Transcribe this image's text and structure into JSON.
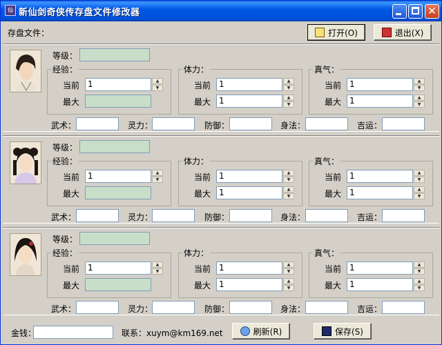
{
  "window": {
    "title": "新仙剑奇侠传存盘文件修改器",
    "icon": "app-icon",
    "controls": {
      "minimize": "minimize-icon",
      "maximize": "maximize-icon",
      "close": "close-icon"
    }
  },
  "toolbar": {
    "save_file_label": "存盘文件：",
    "open_label": "打开(O)",
    "exit_label": "退出(X)",
    "exit_icon_text": "EXIT"
  },
  "labels": {
    "level": "等级：",
    "exp": "经验：",
    "hp": "体力：",
    "mp": "真气：",
    "current": "当前",
    "max": "最大",
    "wushu": "武术：",
    "lingli": "灵力：",
    "fangyu": "防御：",
    "shenfa": "身法：",
    "jiyun": "吉运："
  },
  "characters": [
    {
      "name_icon": "li-xiaoyao-portrait",
      "level": "",
      "exp_current": "1",
      "exp_max": "",
      "hp_current": "1",
      "hp_max": "1",
      "mp_current": "1",
      "mp_max": "1",
      "wushu": "",
      "lingli": "",
      "fangyu": "",
      "shenfa": "",
      "jiyun": ""
    },
    {
      "name_icon": "zhao-linger-portrait",
      "level": "",
      "exp_current": "1",
      "exp_max": "",
      "hp_current": "1",
      "hp_max": "1",
      "mp_current": "1",
      "mp_max": "1",
      "wushu": "",
      "lingli": "",
      "fangyu": "",
      "shenfa": "",
      "jiyun": ""
    },
    {
      "name_icon": "lin-yueru-portrait",
      "level": "",
      "exp_current": "1",
      "exp_max": "",
      "hp_current": "1",
      "hp_max": "1",
      "mp_current": "1",
      "mp_max": "1",
      "wushu": "",
      "lingli": "",
      "fangyu": "",
      "shenfa": "",
      "jiyun": ""
    }
  ],
  "footer": {
    "money_label": "金钱：",
    "money_value": "",
    "contact_label": "联系：xuym@km169.net",
    "refresh_label": "刷新(R)",
    "save_label": "保存(S)"
  },
  "colors": {
    "titlebar": "#0054e3",
    "readonly_field": "#c8dec8",
    "window_bg": "#d4d0c8"
  }
}
